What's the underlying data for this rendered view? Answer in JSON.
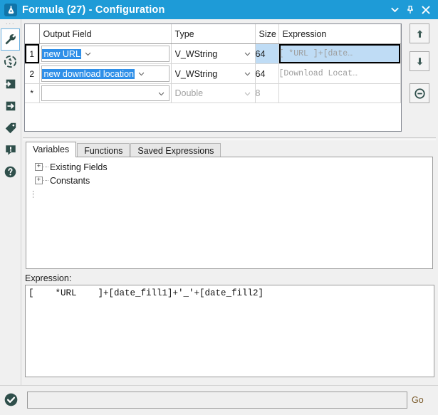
{
  "window": {
    "title": "Formula (27) - Configuration",
    "icon": "formula-flask-icon",
    "accent_color": "#1e9bd7",
    "controls": {
      "menu": "chevron-down-icon",
      "pin": "pin-icon",
      "close": "close-icon"
    }
  },
  "rail": {
    "grip": "···",
    "items": [
      {
        "icon": "wrench-icon",
        "selected": true
      },
      {
        "icon": "target-compass-icon",
        "selected": false
      },
      {
        "icon": "arrow-into-box-icon",
        "selected": false
      },
      {
        "icon": "arrow-out-of-box-icon",
        "selected": false
      },
      {
        "icon": "tag-icon",
        "selected": false
      },
      {
        "icon": "warning-bubble-icon",
        "selected": false
      },
      {
        "icon": "help-question-icon",
        "selected": false
      }
    ],
    "bottom_icon": "check-circle-icon"
  },
  "grid": {
    "columns": [
      "",
      "Output Field",
      "Type",
      "Size",
      "Expression"
    ],
    "rows": [
      {
        "number": "1",
        "selected": true,
        "output_field": "new URL",
        "output_field_selected": true,
        "type": "V_WString",
        "size": "64",
        "size_selected": true,
        "expression": "[  *URL  ]+[date…",
        "expression_selected": true,
        "dim": false
      },
      {
        "number": "2",
        "selected": false,
        "output_field": "new download location",
        "output_field_selected": true,
        "type": "V_WString",
        "size": "64",
        "size_selected": false,
        "expression": "[Download  Locat…",
        "expression_selected": false,
        "dim": false
      },
      {
        "number": "*",
        "selected": false,
        "output_field": "",
        "output_field_selected": false,
        "type": "Double",
        "size": "8",
        "size_selected": false,
        "expression": "",
        "expression_selected": false,
        "dim": true
      }
    ],
    "selection_color": "#2f8fe8",
    "cell_highlight_color": "#bfdcf5"
  },
  "side_buttons": [
    {
      "label": "Move Up",
      "icon": "arrow-up-icon"
    },
    {
      "label": "Move Down",
      "icon": "arrow-down-icon"
    },
    {
      "label": "Remove",
      "icon": "circle-minus-icon"
    }
  ],
  "tabs": [
    {
      "label": "Variables",
      "active": true
    },
    {
      "label": "Functions",
      "active": false
    },
    {
      "label": "Saved Expressions",
      "active": false
    }
  ],
  "tree": {
    "nodes": [
      {
        "label": "Existing Fields",
        "expander": "+"
      },
      {
        "label": "Constants",
        "expander": "+"
      }
    ]
  },
  "expression_panel": {
    "label": "Expression:",
    "text": "[    *URL    ]+[date_fill1]+'_'+[date_fill2]"
  },
  "bottom": {
    "search_value": "",
    "search_placeholder": "",
    "go_label": "Go",
    "status_icon": "check-circle-icon"
  }
}
